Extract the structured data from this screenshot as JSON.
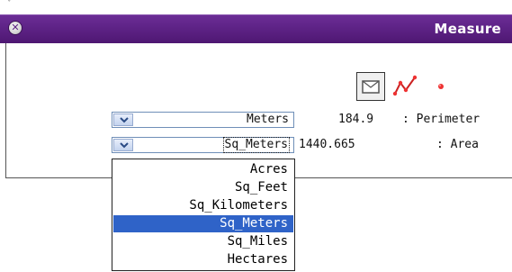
{
  "window": {
    "title": "Measure",
    "close_glyph": "✕"
  },
  "top_caret": "ˇ",
  "tools": [
    {
      "name": "polygon-tool",
      "icon": "envelope-polygon-icon",
      "selected": true
    },
    {
      "name": "line-tool",
      "icon": "polyline-icon"
    },
    {
      "name": "point-tool",
      "icon": "point-icon"
    }
  ],
  "distance": {
    "unit": "Meters",
    "value": "184.9",
    "label": ": Perimeter"
  },
  "area": {
    "unit": "Sq_Meters",
    "value": "1440.665",
    "label": ": Area"
  },
  "dropdown": {
    "options": [
      "Acres",
      "Sq_Feet",
      "Sq_Kilometers",
      "Sq_Meters",
      "Sq_Miles",
      "Hectares"
    ],
    "selected": "Sq_Meters"
  },
  "colors": {
    "titlebar": "#5e2386",
    "selection": "#2f63c8",
    "tool_accent": "#d6222a"
  }
}
